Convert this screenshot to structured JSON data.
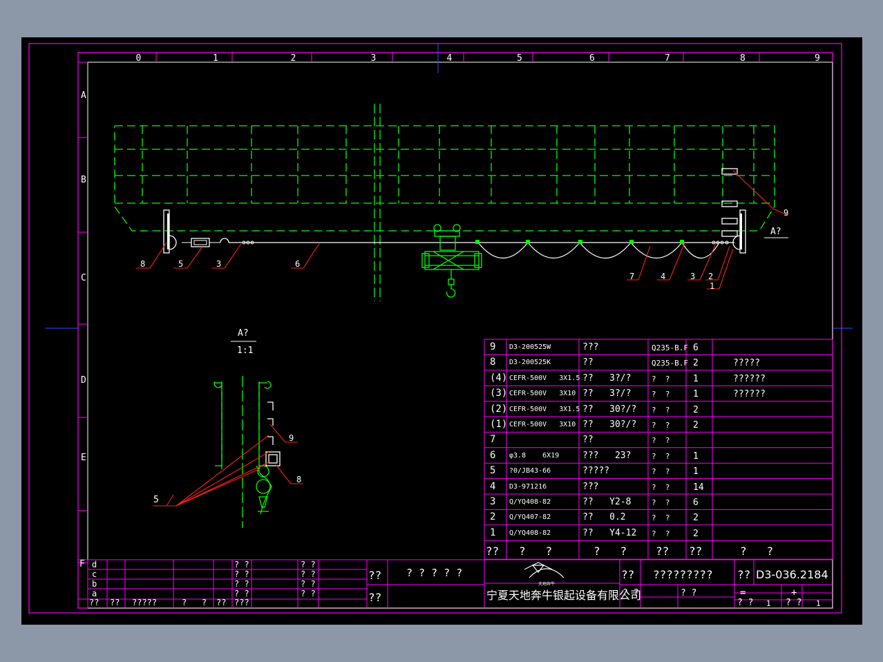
{
  "colors": {
    "background": "#8c98a8",
    "sheet": "#000000",
    "frame": "#ff00ff",
    "crane": "#00ff00",
    "leader": "#ff2020",
    "text": "#ffffff",
    "grid_line": "#ff00ff"
  },
  "zone_columns": [
    "0",
    "1",
    "2",
    "3",
    "4",
    "5",
    "6",
    "7",
    "8",
    "9"
  ],
  "zone_rows": [
    "A",
    "B",
    "C",
    "D",
    "E",
    "F"
  ],
  "main_view": {
    "callouts_left": [
      "8",
      "5",
      "3",
      "6"
    ],
    "callouts_right": [
      "7",
      "4",
      "3",
      "2",
      "1"
    ],
    "callout_9": "9",
    "section_mark": "A?"
  },
  "section_view": {
    "title": "A?",
    "scale": "1:1",
    "callout_9": "9",
    "callout_8": "8",
    "callout_5": "5"
  },
  "bom": [
    {
      "no": "9",
      "code": "D3-200525W",
      "name": "???",
      "material": "Q235-B.F",
      "qty": "6",
      "note": ""
    },
    {
      "no": "8",
      "code": "D3-200525K",
      "name": "??",
      "material": "Q235-B.F",
      "qty": "2",
      "note": "?????"
    },
    {
      "no": "(4)",
      "code": "CEFR-500V   3X1.5",
      "name": "??   3?/?",
      "material": "?  ?",
      "qty": "1",
      "note": "??????"
    },
    {
      "no": "(3)",
      "code": "CEFR-500V   3X10",
      "name": "??   3?/?",
      "material": "?  ?",
      "qty": "1",
      "note": "??????"
    },
    {
      "no": "(2)",
      "code": "CEFR-500V   3X1.5",
      "name": "??   30?/?",
      "material": "?  ?",
      "qty": "2",
      "note": ""
    },
    {
      "no": "(1)",
      "code": "CEFR-500V   3X10",
      "name": "??   30?/?",
      "material": "?  ?",
      "qty": "2",
      "note": ""
    },
    {
      "no": "7",
      "code": "",
      "name": "??",
      "material": "?  ?",
      "qty": "",
      "note": ""
    },
    {
      "no": "6",
      "code": "φ3.8    6X19",
      "name": "???   23?",
      "material": "?  ?",
      "qty": "1",
      "note": ""
    },
    {
      "no": "5",
      "code": "?0/JB43-66",
      "name": "?????",
      "material": "?  ?",
      "qty": "1",
      "note": ""
    },
    {
      "no": "4",
      "code": "D3-971216",
      "name": "???",
      "material": "?  ?",
      "qty": "14",
      "note": ""
    },
    {
      "no": "3",
      "code": "Q/YQ408-82",
      "name": "??   Y2-8",
      "material": "?  ?",
      "qty": "6",
      "note": ""
    },
    {
      "no": "2",
      "code": "Q/YQ407-82",
      "name": "??   0.2",
      "material": "?  ?",
      "qty": "2",
      "note": ""
    },
    {
      "no": "1",
      "code": "Q/YQ408-82",
      "name": "??   Y4-12",
      "material": "?  ?",
      "qty": "2",
      "note": ""
    }
  ],
  "bom_header": {
    "no": "??",
    "code": "?   ?",
    "name": "?   ?",
    "material": "??",
    "qty": "??",
    "note": "?   ?"
  },
  "title_block": {
    "rev_letters": [
      "d",
      "c",
      "b",
      "a"
    ],
    "rev_q_a": [
      "? ?",
      "? ?",
      "? ?",
      "? ?"
    ],
    "rev_q_b": [
      "? ?",
      "? ?",
      "? ?",
      "? ?"
    ],
    "rev_footer": [
      "??",
      "??",
      "?????",
      "?   ?",
      "??",
      "???"
    ],
    "label_design": "??",
    "label_check": "??",
    "project_name": "? ? ? ? ?",
    "company": "宁夏天地奔牛银起设备有限公司",
    "logo_text": "天地奔牛",
    "drawing_title_label": "??",
    "drawing_title": "?????????",
    "drawing_no_label": "??",
    "drawing_no": "D3-036.2184",
    "mid_label_1": "? ?",
    "mid_label_2": "? ?",
    "equal_sign": "=",
    "plus_sign": "+",
    "bottom_q_1": "? ?",
    "bottom_one_1": "1",
    "bottom_q_2": "? ?",
    "bottom_one_2": "1",
    "row_f": "F"
  }
}
